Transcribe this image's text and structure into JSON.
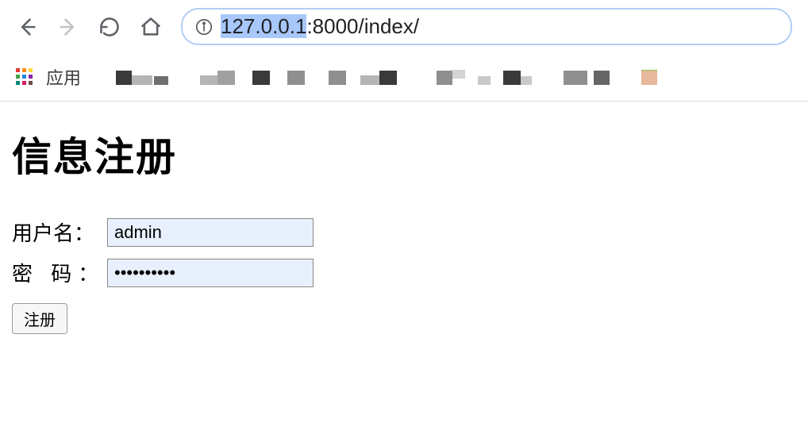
{
  "browser": {
    "url": "127.0.0.1:8000/index/",
    "url_selected": "127.0.0.1",
    "url_rest": ":8000/index/"
  },
  "bookmarks": {
    "apps_label": "应用"
  },
  "page": {
    "title": "信息注册",
    "username_label": "用户名：",
    "password_label": "密 码：",
    "username_value": "admin",
    "password_value": "••••••••••",
    "submit_label": "注册"
  }
}
